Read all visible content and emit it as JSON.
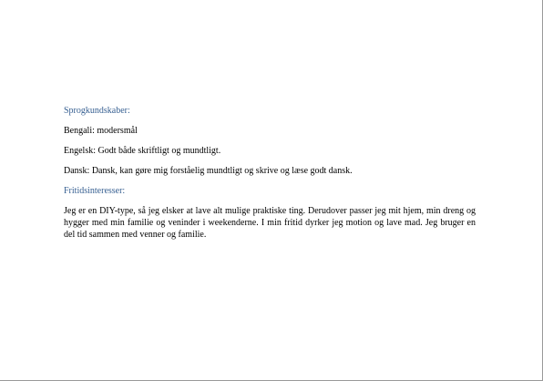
{
  "document": {
    "sections": {
      "languages": {
        "heading": "Sprogkundskaber:",
        "items": [
          "Bengali: modersmål",
          "Engelsk: Godt både skriftligt og mundtligt.",
          "Dansk: Dansk, kan gøre mig forståelig mundtligt og skrive og læse godt dansk."
        ]
      },
      "hobbies": {
        "heading": "Fritidsinteresser:",
        "text": "Jeg er en DIY-type, så jeg elsker at lave alt mulige praktiske ting. Derudover passer jeg mit hjem, min dreng og hygger med min familie og veninder i weekenderne. I min fritid dyrker jeg motion og lave mad. Jeg bruger en del tid sammen med venner og familie."
      }
    },
    "colors": {
      "heading": "#365f91",
      "text": "#000000",
      "page_border": "#9a9a9a"
    }
  }
}
